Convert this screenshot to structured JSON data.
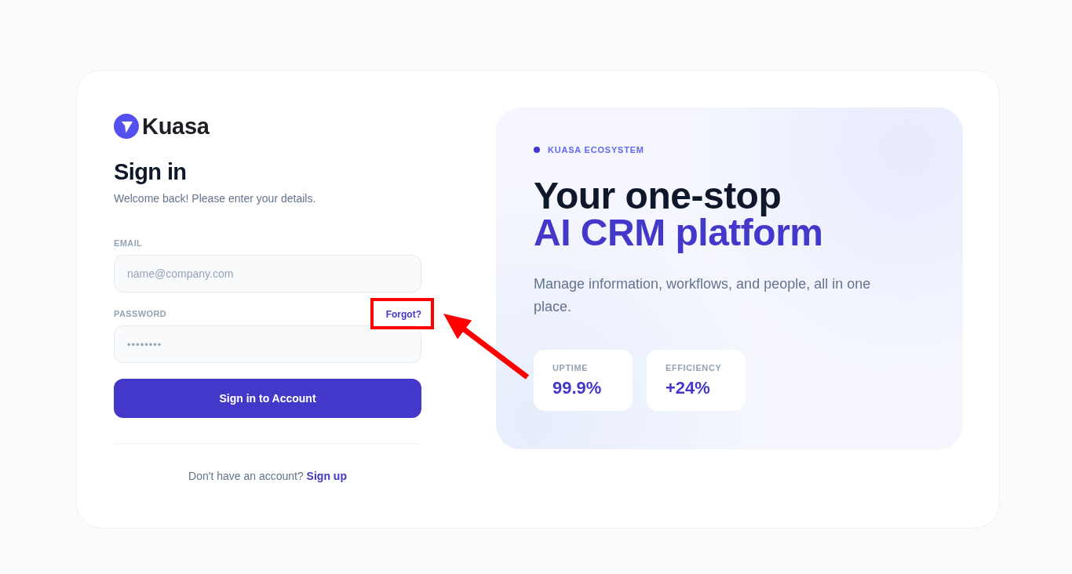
{
  "brand": {
    "name": "Kuasa"
  },
  "sign_in": {
    "title": "Sign in",
    "subtitle": "Welcome back! Please enter your details.",
    "fields": [
      {
        "kind": "email",
        "label": "EMAIL",
        "placeholder": "name@company.com"
      },
      {
        "kind": "password",
        "label": "PASSWORD",
        "value": "••••••••",
        "link": {
          "label": "Forgot?",
          "highlighted": true
        }
      }
    ],
    "submit_button": "Sign in to Account",
    "footer": {
      "text": "Don't have an account?",
      "link": "Sign up"
    }
  },
  "hero": {
    "eyebrow": "KUASA ECOSYSTEM",
    "headline": [
      {
        "text": "Your one-stop",
        "accent": false
      },
      {
        "text": "AI CRM platform",
        "accent": true
      }
    ],
    "description": "Manage information, workflows, and people, all in one place.",
    "stats": [
      {
        "label": "UPTIME",
        "value": "99.9%"
      },
      {
        "label": "EFFICIENCY",
        "value": "+24%"
      }
    ]
  }
}
